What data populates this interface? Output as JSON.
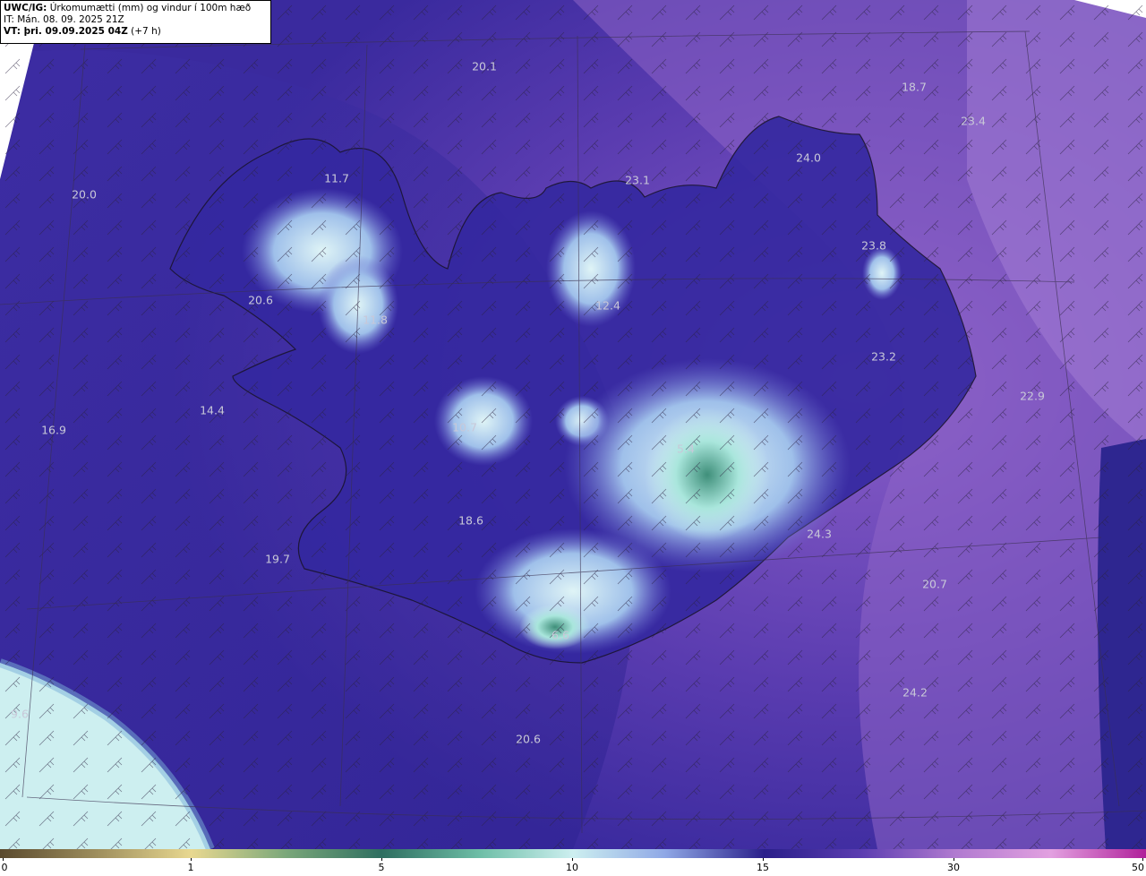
{
  "header": {
    "model": "UWC/IG:",
    "title": "Úrkomumætti (mm) og vindur í 100m hæð",
    "init_time": "IT: Mán. 08. 09. 2025 21Z",
    "valid_label": "VT: þri. 09.09.2025 04Z",
    "lead": "(+7 h)"
  },
  "map_values": [
    {
      "text": "20.1"
    },
    {
      "text": "18.7"
    },
    {
      "text": "23.4"
    },
    {
      "text": "24.0"
    },
    {
      "text": "23.1"
    },
    {
      "text": "11.7"
    },
    {
      "text": "20.0"
    },
    {
      "text": "23.8"
    },
    {
      "text": "12.4"
    },
    {
      "text": "20.6"
    },
    {
      "text": "11.8"
    },
    {
      "text": "23.2"
    },
    {
      "text": "22.9"
    },
    {
      "text": "14.4"
    },
    {
      "text": "10.7"
    },
    {
      "text": "16.9"
    },
    {
      "text": "5.4"
    },
    {
      "text": "18.6"
    },
    {
      "text": "24.3"
    },
    {
      "text": "19.7"
    },
    {
      "text": "20.7"
    },
    {
      "text": "6.6"
    },
    {
      "text": "24.2"
    },
    {
      "text": "9.6"
    },
    {
      "text": "20.6"
    }
  ],
  "colorbar": {
    "ticks": [
      "0",
      "1",
      "5",
      "10",
      "15",
      "30",
      "50"
    ],
    "colors": {
      "dry": "#5a4a2e",
      "low": "#e8d890",
      "mid": "#2e6e60",
      "pale": "#cdeff0",
      "high": "#2a1f8a",
      "violet": "#b07ad0",
      "max": "#b0209a"
    }
  }
}
